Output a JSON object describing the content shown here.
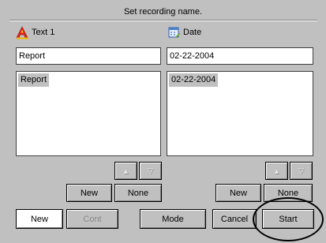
{
  "dialog": {
    "title": "Set recording name."
  },
  "left": {
    "header_label": "Text 1",
    "header_icon": "text-a-icon",
    "field_value": "Report",
    "list_items": [
      "Report"
    ],
    "up_icon": "arrow-up-icon",
    "down_icon": "arrow-down-icon",
    "new_label": "New",
    "none_label": "None"
  },
  "right": {
    "header_label": "Date",
    "header_icon": "calendar-icon",
    "field_value": "02-22-2004",
    "list_items": [
      "02-22-2004"
    ],
    "up_icon": "arrow-up-icon",
    "down_icon": "arrow-down-icon",
    "new_label": "New",
    "none_label": "None"
  },
  "bottom": {
    "new_label": "New",
    "cont_label": "Cont",
    "mode_label": "Mode",
    "cancel_label": "Cancel",
    "start_label": "Start"
  },
  "colors": {
    "background": "#c0c0c0",
    "field": "#ffffff",
    "selection": "#c0c0c0",
    "icon_a": "#e8231e"
  }
}
